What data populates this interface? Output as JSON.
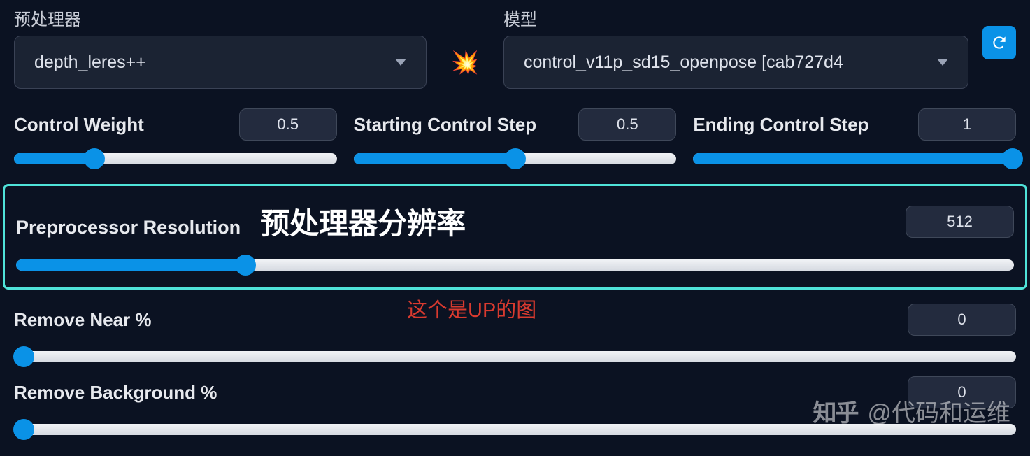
{
  "labels": {
    "preprocessor": "预处理器",
    "model": "模型"
  },
  "dropdowns": {
    "preprocessor_value": "depth_leres++",
    "model_value": "control_v11p_sd15_openpose [cab727d4"
  },
  "sliders": {
    "control_weight": {
      "label": "Control Weight",
      "value": "0.5",
      "fill_pct": 25
    },
    "starting_step": {
      "label": "Starting Control Step",
      "value": "0.5",
      "fill_pct": 50
    },
    "ending_step": {
      "label": "Ending Control Step",
      "value": "1",
      "fill_pct": 100
    },
    "preproc_res": {
      "label_en": "Preprocessor Resolution",
      "label_cn": "预处理器分辨率",
      "value": "512",
      "fill_pct": 23
    },
    "remove_near": {
      "label": "Remove Near %",
      "value": "0",
      "fill_pct": 1
    },
    "remove_bg": {
      "label": "Remove Background %",
      "value": "0",
      "fill_pct": 1
    }
  },
  "annotation": {
    "red_text": "这个是UP的图"
  },
  "watermark": {
    "logo": "知乎",
    "text": "@代码和运维"
  }
}
